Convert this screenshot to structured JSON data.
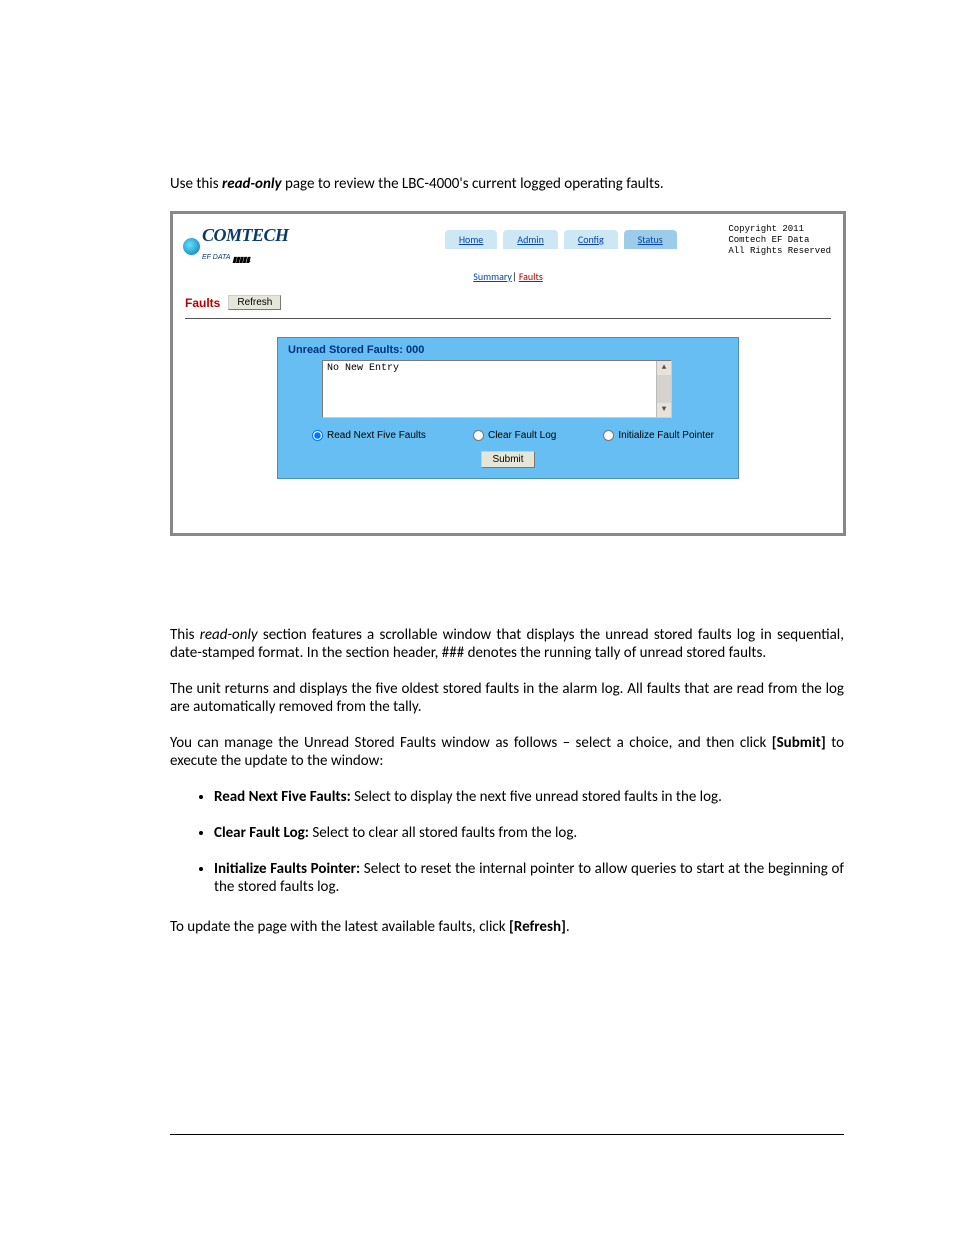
{
  "intro": {
    "prefix": "Use this ",
    "readonly": "read-only",
    "suffix": " page to review the LBC-4000's current logged operating faults."
  },
  "screenshot": {
    "logo": {
      "main": "COMTECH",
      "sub": "EF DATA",
      "bars": "▮▮▮▮▮."
    },
    "tabs": {
      "home": "Home",
      "admin": "Admin",
      "config": "Config",
      "status": "Status"
    },
    "subnav": {
      "summary": "Summary",
      "sep": "| ",
      "faults": "Faults"
    },
    "copyright": "Copyright 2011\nComtech EF Data\nAll Rights Reserved",
    "faults_label": "Faults",
    "refresh_label": "Refresh",
    "panel_title": "Unread Stored Faults: 000",
    "scroll_content": "No New Entry",
    "radios": {
      "read_next": "Read Next Five Faults",
      "clear_log": "Clear Fault Log",
      "init_ptr": "Initialize Fault Pointer"
    },
    "submit_label": "Submit"
  },
  "body": {
    "p1_a": "This ",
    "p1_ro": "read-only",
    "p1_b": " section features a scrollable window that displays the unread stored faults log in sequential, date-stamped format. In the section header, ### denotes the running tally of unread stored faults.",
    "p2": "The unit returns and displays the five oldest stored faults in the alarm log. All faults that are read from the log are automatically removed from the tally.",
    "p3_a": "You can manage the Unread Stored Faults window as follows – select a choice, and then click ",
    "p3_submit": "[Submit]",
    "p3_b": " to execute the update to the window:",
    "bullets": {
      "b1_label": "Read Next Five Faults:",
      "b1_text": " Select to display the next five unread stored faults in the log.",
      "b2_label": "Clear Fault Log:",
      "b2_text": " Select to clear all stored faults from the log.",
      "b3_label": "Initialize Faults Pointer:",
      "b3_text": " Select to reset the internal pointer to allow queries to start at the beginning of the stored faults log."
    },
    "p4_a": "To update the page with the latest available faults, click ",
    "p4_refresh": "[Refresh]",
    "p4_b": "."
  }
}
